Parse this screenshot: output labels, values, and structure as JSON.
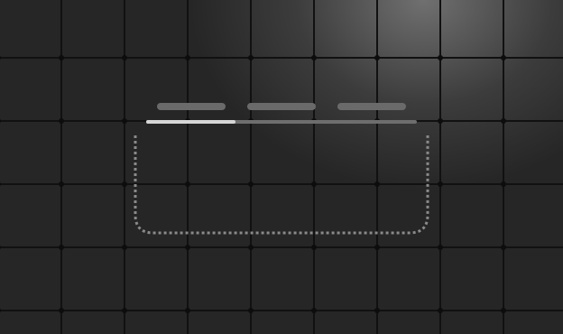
{
  "app": {
    "tabs": [
      {
        "label": ""
      },
      {
        "label": ""
      },
      {
        "label": ""
      }
    ],
    "progress": {
      "fraction": 0.33
    },
    "colors": {
      "background": "#262626",
      "grid_line": "#111111",
      "grid_node": "#0d0d0d",
      "tab": "#6a6a6a",
      "track": "#6e6e6e",
      "fill": "#d6d6d6",
      "dashed_border": "#8a8a8a"
    }
  }
}
